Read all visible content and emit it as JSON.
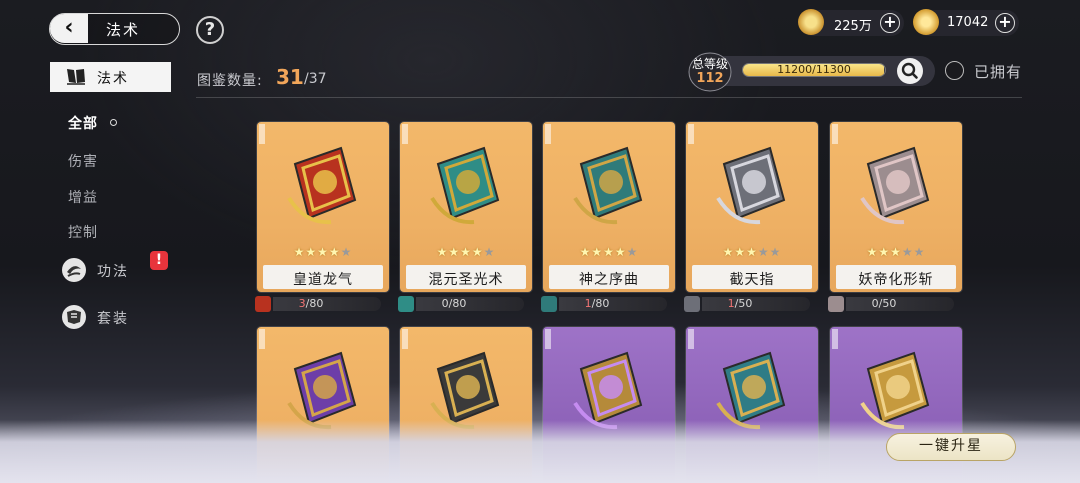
{
  "header": {
    "back_title": "法术",
    "help_glyph": "?"
  },
  "currency": [
    {
      "icon": "coin-icon",
      "value": "225万",
      "plus": "+"
    },
    {
      "icon": "ingot-icon",
      "value": "17042",
      "plus": "+"
    }
  ],
  "sidebar": {
    "active_tab": "法术",
    "sub_items": [
      "全部",
      "伤害",
      "增益",
      "控制"
    ],
    "sections": [
      {
        "label": "功法",
        "icon": "technique-icon",
        "alert": "!"
      },
      {
        "label": "套装",
        "icon": "set-icon"
      }
    ]
  },
  "catalog": {
    "label": "图鉴数量:",
    "owned": "31",
    "total": "/37"
  },
  "level": {
    "title": "总等级",
    "value": "112",
    "progress_text": "11200/11300",
    "progress_fraction": 0.991
  },
  "filter": {
    "owned_label": "已拥有"
  },
  "cards_row1": [
    {
      "name": "皇道龙气",
      "stars": 4,
      "max_stars": 5,
      "have": "3",
      "need": "/80",
      "rarity": "gold"
    },
    {
      "name": "混元圣光术",
      "stars": 4,
      "max_stars": 5,
      "have": "0",
      "need": "/80",
      "rarity": "gold"
    },
    {
      "name": "神之序曲",
      "stars": 4,
      "max_stars": 5,
      "have": "1",
      "need": "/80",
      "rarity": "gold"
    },
    {
      "name": "截天指",
      "stars": 3,
      "max_stars": 5,
      "have": "1",
      "need": "/50",
      "rarity": "gold"
    },
    {
      "name": "妖帝化形斩",
      "stars": 3,
      "max_stars": 5,
      "have": "0",
      "need": "/50",
      "rarity": "gold"
    }
  ],
  "cards_row2": [
    {
      "rarity": "gold"
    },
    {
      "rarity": "gold"
    },
    {
      "rarity": "purple"
    },
    {
      "rarity": "purple"
    },
    {
      "rarity": "purple"
    }
  ],
  "actions": {
    "upstar_all": "一键升星"
  },
  "colors": {
    "accent_orange": "#f2a65a",
    "gold_card": "#f3b86a",
    "purple_card": "#9e73c7",
    "alert_red": "#e8343c"
  }
}
